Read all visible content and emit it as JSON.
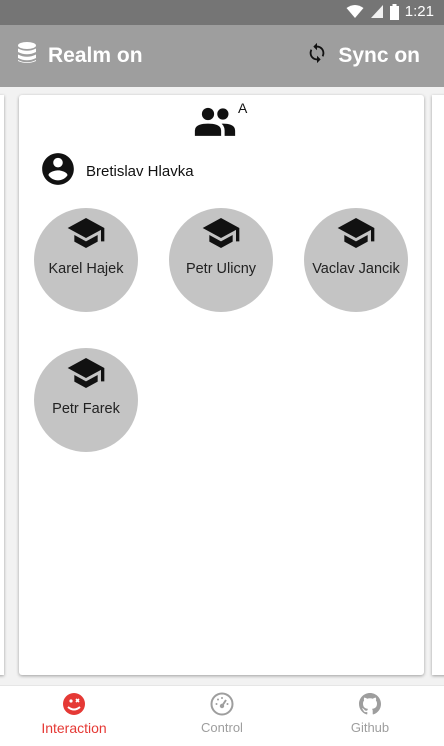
{
  "status_bar": {
    "time": "1:21"
  },
  "app_bar": {
    "realm_label": "Realm on",
    "sync_label": "Sync on"
  },
  "group": {
    "letter": "A",
    "teacher_name": "Bretislav Hlavka",
    "students": [
      "Karel Hajek",
      "Petr Ulicny",
      "Vaclav Jancik",
      "Petr Farek"
    ]
  },
  "bottom_nav": {
    "items": [
      {
        "label": "Interaction",
        "icon": "interaction-icon",
        "active": true
      },
      {
        "label": "Control",
        "icon": "speedometer-icon",
        "active": false
      },
      {
        "label": "Github",
        "icon": "github-icon",
        "active": false
      }
    ]
  },
  "colors": {
    "status_bar": "#757575",
    "app_bar": "#9e9e9e",
    "active_accent": "#e53935",
    "bubble": "#c4c4c4"
  }
}
